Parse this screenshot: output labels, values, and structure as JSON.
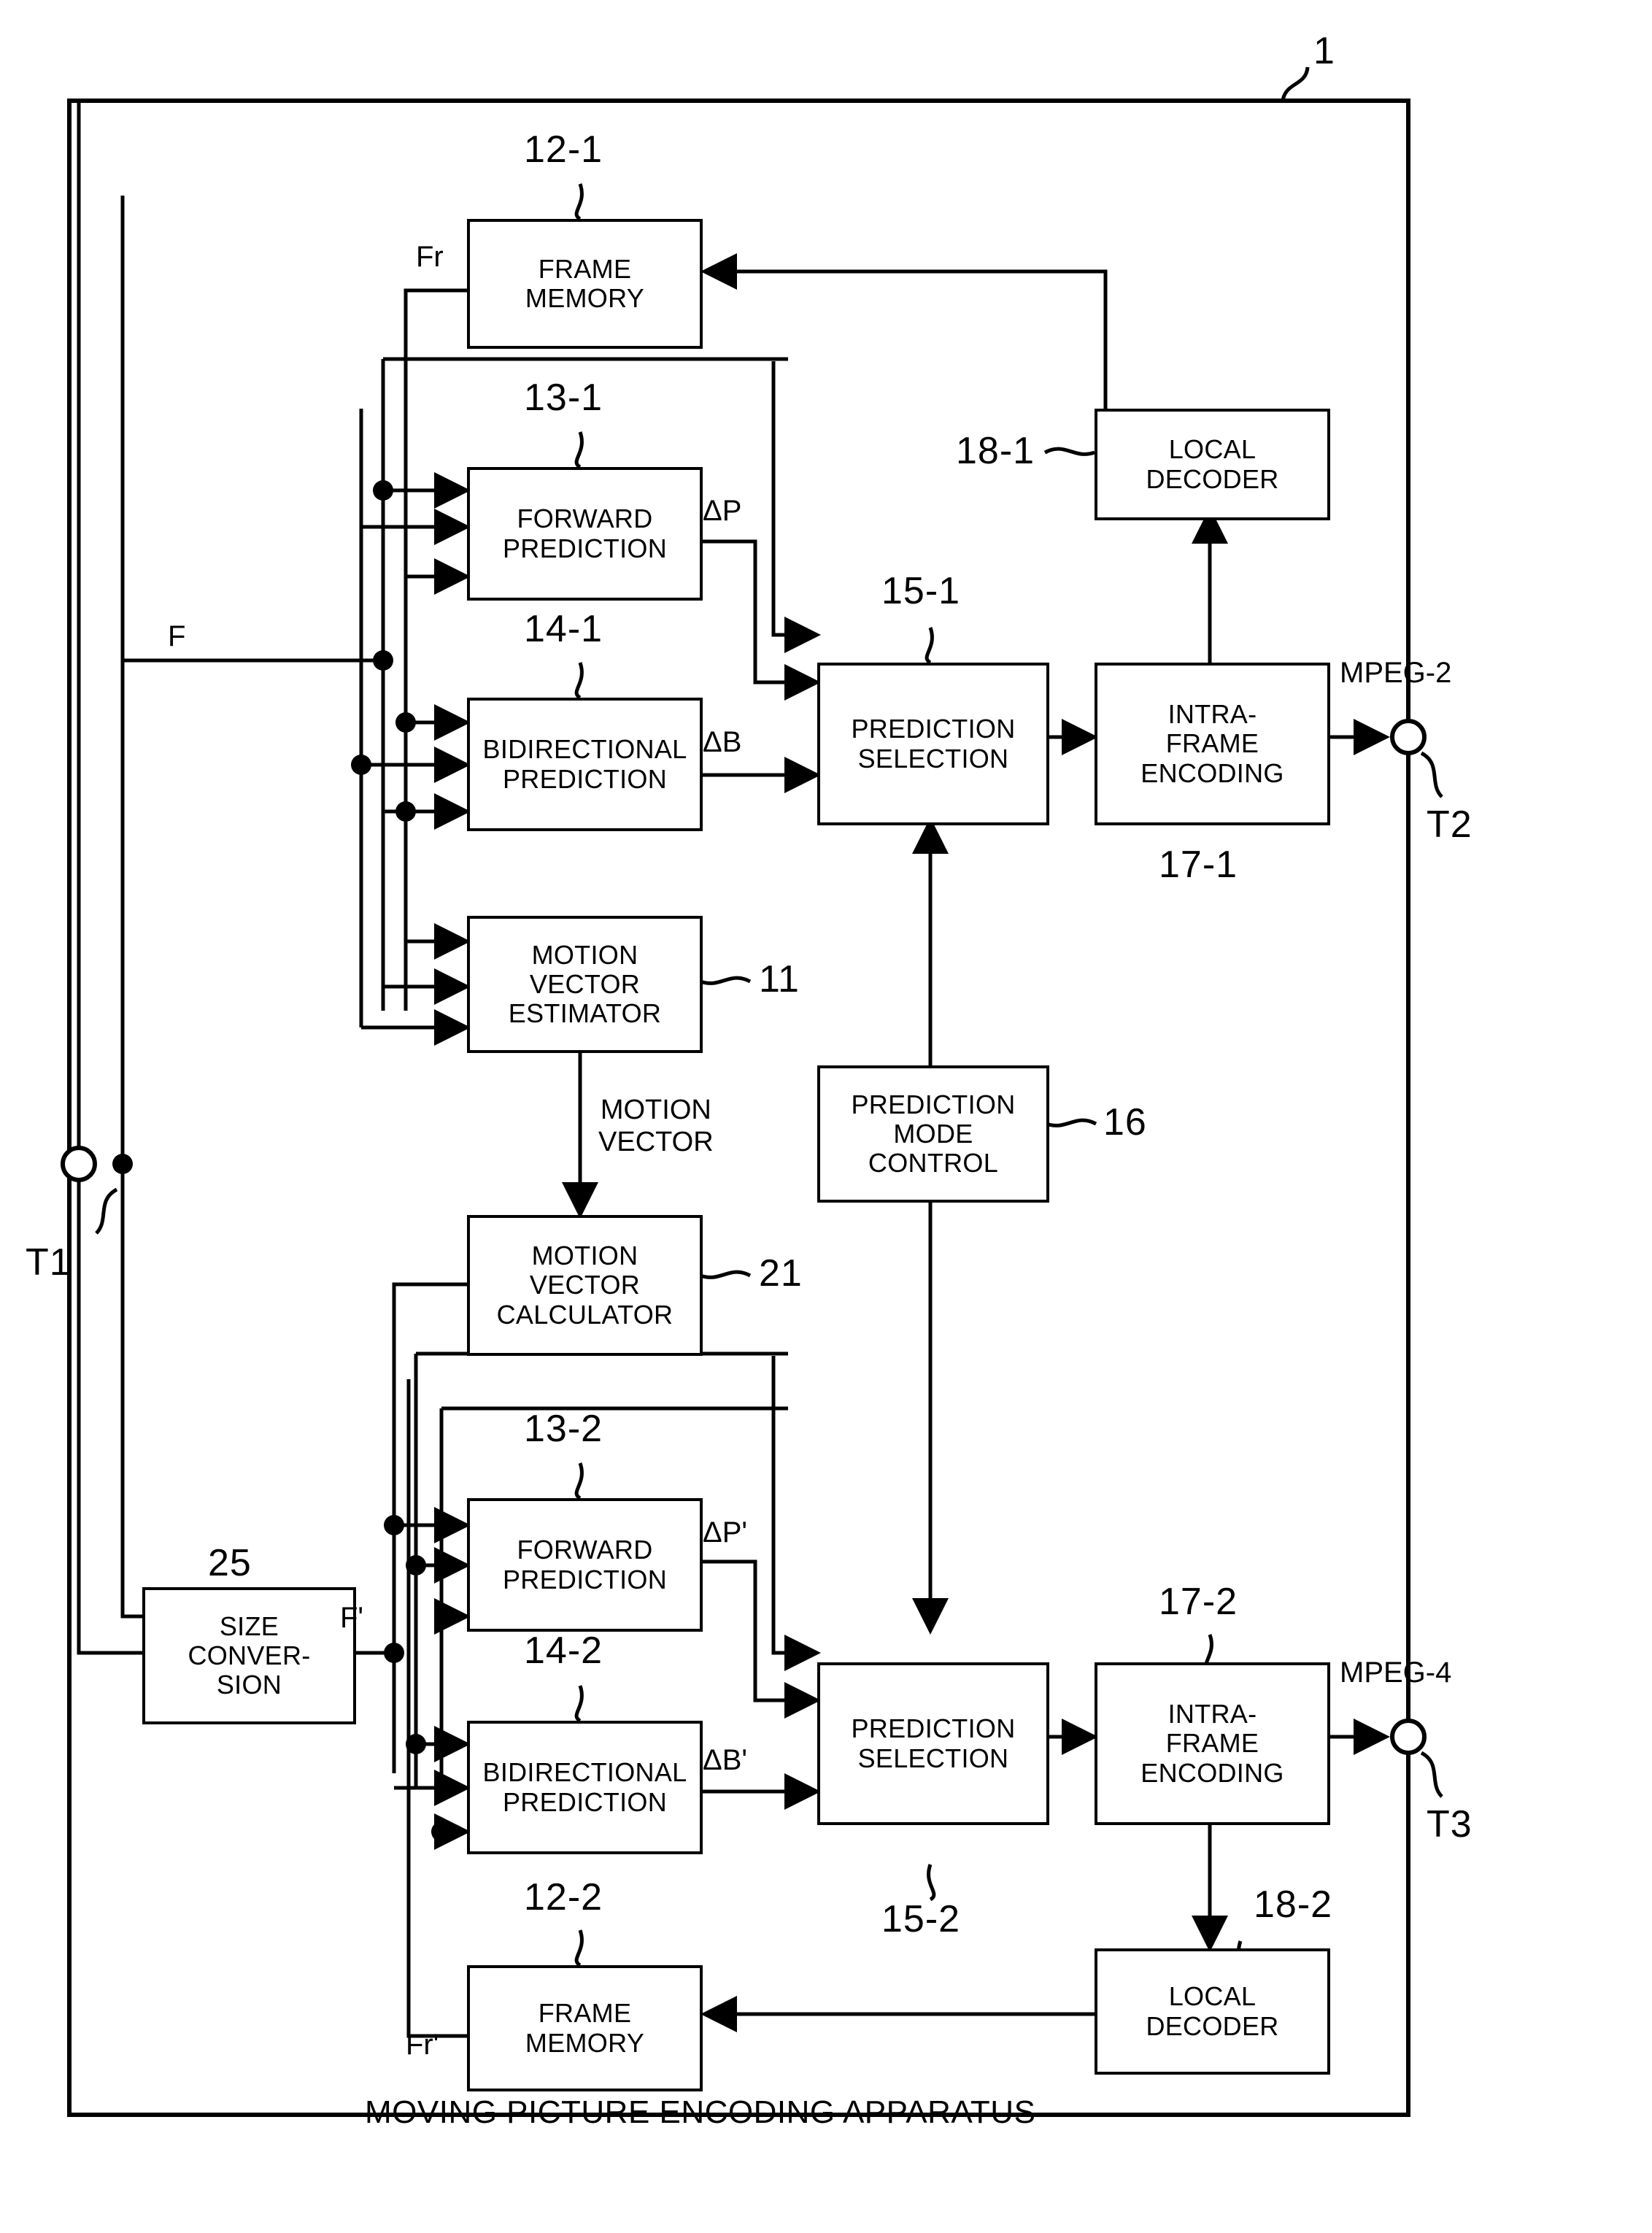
{
  "figure": {
    "apparatus_ref": "1",
    "caption": "MOVING PICTURE ENCODING APPARATUS"
  },
  "blocks": [
    {
      "id": "frame-memory-1",
      "ref": "12-1",
      "lines": [
        "FRAME",
        "MEMORY"
      ]
    },
    {
      "id": "forward-prediction-1",
      "ref": "13-1",
      "lines": [
        "FORWARD",
        "PREDICTION"
      ]
    },
    {
      "id": "bidirectional-prediction-1",
      "ref": "14-1",
      "lines": [
        "BIDIRECTIONAL",
        "PREDICTION"
      ]
    },
    {
      "id": "motion-vector-estimator",
      "ref": "11",
      "lines": [
        "MOTION",
        "VECTOR",
        "ESTIMATOR"
      ]
    },
    {
      "id": "prediction-selection-1",
      "ref": "15-1",
      "lines": [
        "PREDICTION",
        "SELECTION"
      ]
    },
    {
      "id": "intra-frame-encoding-1",
      "ref": "17-1",
      "lines": [
        "INTRA-",
        "FRAME",
        "ENCODING"
      ]
    },
    {
      "id": "local-decoder-1",
      "ref": "18-1",
      "lines": [
        "LOCAL",
        "DECODER"
      ]
    },
    {
      "id": "prediction-mode-control",
      "ref": "16",
      "lines": [
        "PREDICTION",
        "MODE",
        "CONTROL"
      ]
    },
    {
      "id": "motion-vector-calculator",
      "ref": "21",
      "lines": [
        "MOTION",
        "VECTOR",
        "CALCULATOR"
      ]
    },
    {
      "id": "size-conversion",
      "ref": "25",
      "lines": [
        "SIZE",
        "CONVER-",
        "SION"
      ]
    },
    {
      "id": "forward-prediction-2",
      "ref": "13-2",
      "lines": [
        "FORWARD",
        "PREDICTION"
      ]
    },
    {
      "id": "bidirectional-prediction-2",
      "ref": "14-2",
      "lines": [
        "BIDIRECTIONAL",
        "PREDICTION"
      ]
    },
    {
      "id": "prediction-selection-2",
      "ref": "15-2",
      "lines": [
        "PREDICTION",
        "SELECTION"
      ]
    },
    {
      "id": "intra-frame-encoding-2",
      "ref": "17-2",
      "lines": [
        "INTRA-",
        "FRAME",
        "ENCODING"
      ]
    },
    {
      "id": "local-decoder-2",
      "ref": "18-2",
      "lines": [
        "LOCAL",
        "DECODER"
      ]
    },
    {
      "id": "frame-memory-2",
      "ref": "12-2",
      "lines": [
        "FRAME",
        "MEMORY"
      ]
    }
  ],
  "signals": {
    "fr_upper": "Fr",
    "fr_lower": "Fr'",
    "f_input": "F",
    "f_prime": "F'",
    "delta_p": "ΔP",
    "delta_b": "ΔB",
    "delta_p_prime": "ΔP'",
    "delta_b_prime": "ΔB'",
    "motion_vector": [
      "MOTION",
      "VECTOR"
    ],
    "mpeg2": "MPEG-2",
    "mpeg4": "MPEG-4"
  },
  "terminals": [
    {
      "id": "t1",
      "label": "T1"
    },
    {
      "id": "t2",
      "label": "T2"
    },
    {
      "id": "t3",
      "label": "T3"
    }
  ],
  "refnums": {
    "apparatus": "1",
    "frame_memory_1": "12-1",
    "forward_prediction_1": "13-1",
    "bidirectional_prediction_1": "14-1",
    "motion_vector_estimator": "11",
    "prediction_selection_1": "15-1",
    "intra_frame_encoding_1": "17-1",
    "local_decoder_1": "18-1",
    "prediction_mode_control": "16",
    "motion_vector_calculator": "21",
    "size_conversion": "25",
    "forward_prediction_2": "13-2",
    "bidirectional_prediction_2": "14-2",
    "prediction_selection_2": "15-2",
    "intra_frame_encoding_2": "17-2",
    "local_decoder_2": "18-2",
    "frame_memory_2": "12-2"
  },
  "colors": {
    "ink": "#000000",
    "paper": "#ffffff"
  }
}
